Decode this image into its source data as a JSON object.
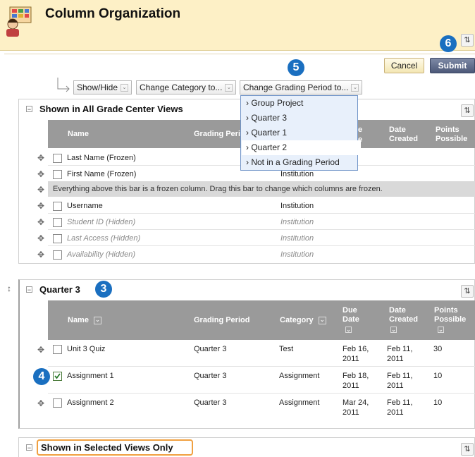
{
  "header": {
    "title": "Column Organization"
  },
  "callouts": {
    "c3": "3",
    "c4": "4",
    "c5": "5",
    "c6": "6"
  },
  "buttons": {
    "cancel": "Cancel",
    "submit": "Submit"
  },
  "toolbar": {
    "show_hide": "Show/Hide",
    "change_category": "Change Category to...",
    "change_grading_period": "Change Grading Period to..."
  },
  "dropdown": {
    "items": [
      "Group Project",
      "Quarter 3",
      "Quarter 1",
      "Quarter 2",
      "Not in a Grading Period"
    ],
    "selected": "Quarter 2"
  },
  "section1": {
    "title": "Shown in All Grade Center Views",
    "columns": {
      "name": "Name",
      "grading_period": "Grading Peri",
      "due": "e",
      "date_created": "Date Created",
      "points_possible": "Points Possible",
      "due_partial": "e"
    },
    "rows": [
      {
        "name": "Last Name (Frozen)",
        "period": ""
      },
      {
        "name": "First Name (Frozen)",
        "period": "Institution"
      }
    ],
    "frozen_bar": "Everything above this bar is a frozen column. Drag this bar to change which columns are frozen.",
    "rows_after": [
      {
        "name": "Username",
        "period": "Institution"
      },
      {
        "name": "Student ID (Hidden)",
        "period": "Institution"
      },
      {
        "name": "Last Access (Hidden)",
        "period": "Institution"
      },
      {
        "name": "Availability (Hidden)",
        "period": "Institution"
      }
    ]
  },
  "section2": {
    "title": "Quarter 3",
    "columns": {
      "name": "Name",
      "grading_period": "Grading Period",
      "category": "Category",
      "due_date": "Due Date",
      "date_created": "Date Created",
      "points_possible": "Points Possible"
    },
    "rows": [
      {
        "name": "Unit 3 Quiz",
        "period": "Quarter 3",
        "category": "Test",
        "due1": "Feb 16,",
        "due2": "2011",
        "created1": "Feb 11,",
        "created2": "2011",
        "points": "30",
        "checked": false
      },
      {
        "name": "Assignment 1",
        "period": "Quarter 3",
        "category": "Assignment",
        "due1": "Feb 18,",
        "due2": "2011",
        "created1": "Feb 11,",
        "created2": "2011",
        "points": "10",
        "checked": true
      },
      {
        "name": "Assignment 2",
        "period": "Quarter 3",
        "category": "Assignment",
        "due1": "Mar 24,",
        "due2": "2011",
        "created1": "Feb 11,",
        "created2": "2011",
        "points": "10",
        "checked": false
      }
    ]
  },
  "section3": {
    "title": "Shown in Selected Views Only"
  },
  "colors": {
    "callout": "#1a6fc0",
    "header_bg": "#fdf0c6",
    "table_head": "#9a9a9a",
    "highlight_box": "#f0a040"
  }
}
